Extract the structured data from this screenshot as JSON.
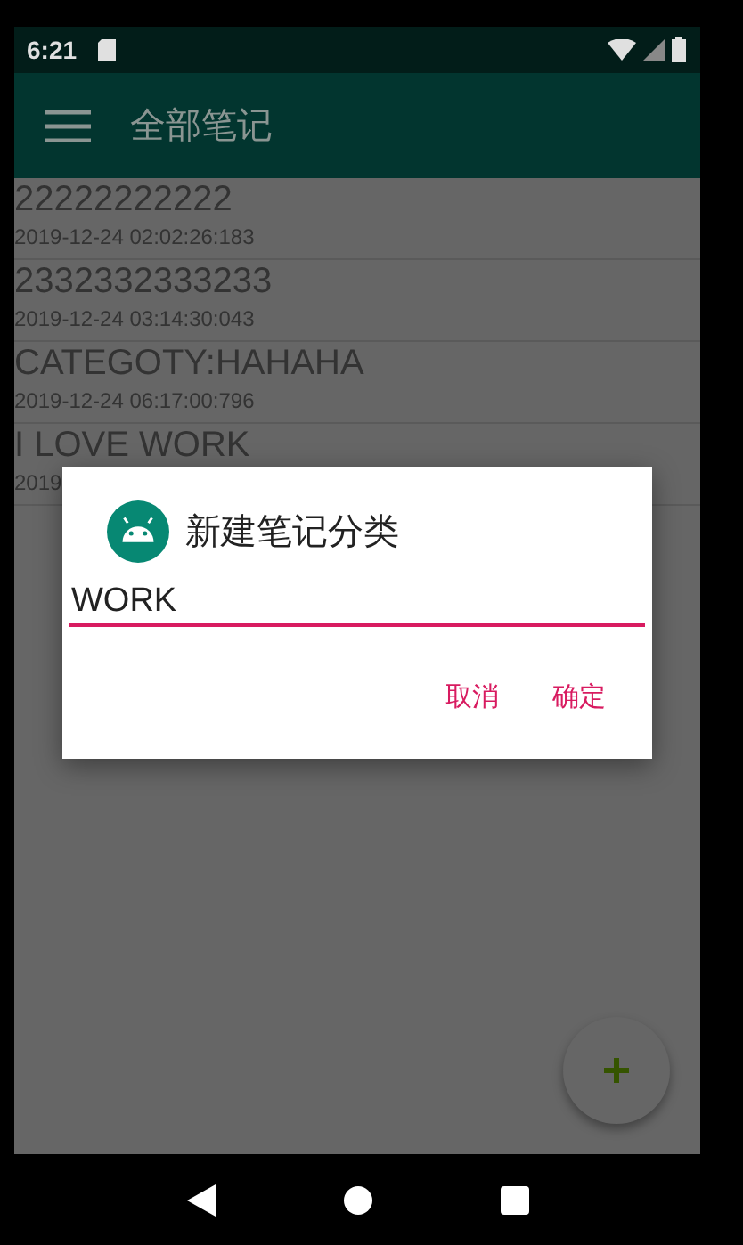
{
  "status_bar": {
    "time": "6:21"
  },
  "app_bar": {
    "title": "全部笔记"
  },
  "notes": [
    {
      "title": "22222222222",
      "date": "2019-12-24 02:02:26:183"
    },
    {
      "title": "2332332333233",
      "date": "2019-12-24 03:14:30:043"
    },
    {
      "title": "CATEGOTY:HAHAHA",
      "date": "2019-12-24 06:17:00:796"
    },
    {
      "title": "I LOVE WORK",
      "date": "2019"
    }
  ],
  "dialog": {
    "title": "新建笔记分类",
    "value": "WORK",
    "buttons": [
      "取消",
      "确定"
    ]
  }
}
